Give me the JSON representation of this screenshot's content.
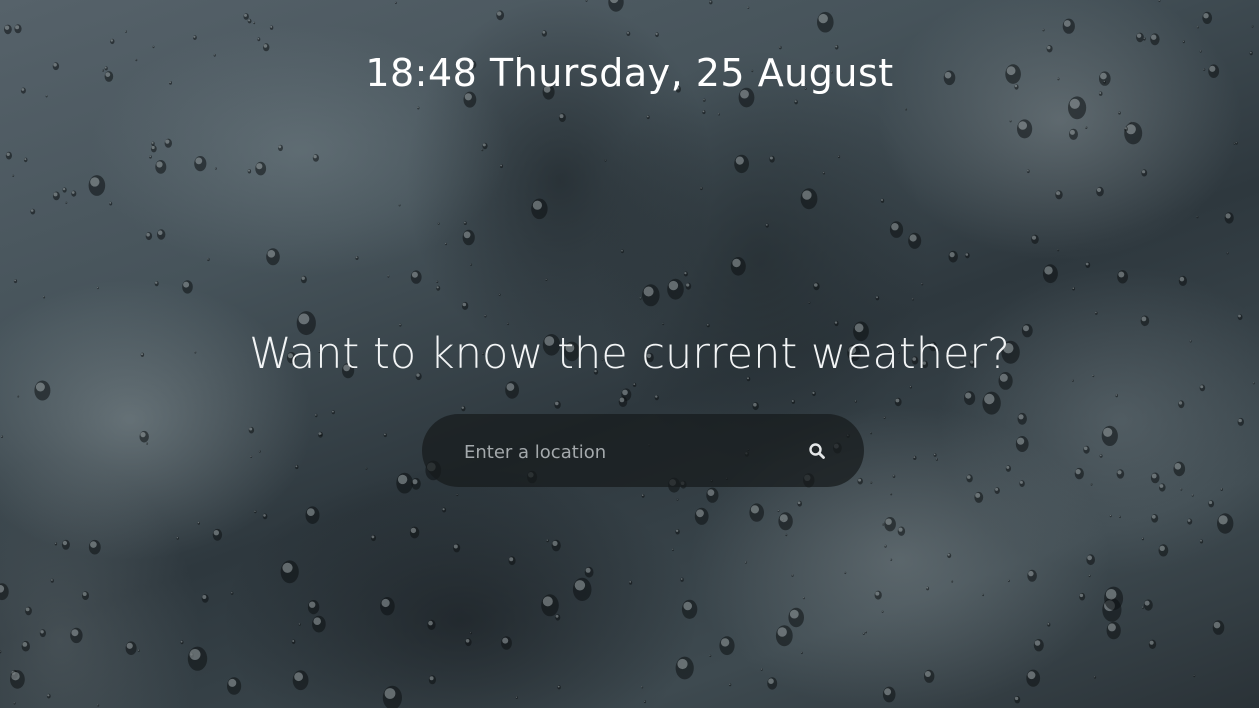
{
  "header": {
    "datetime": "18:48 Thursday, 25 August"
  },
  "main": {
    "headline": "Want to know the current weather?"
  },
  "search": {
    "placeholder": "Enter a location",
    "value": "",
    "icon": "search-icon"
  },
  "colors": {
    "text": "#ffffff",
    "search_background": "#161a1c",
    "placeholder": "#a4a9ac"
  }
}
